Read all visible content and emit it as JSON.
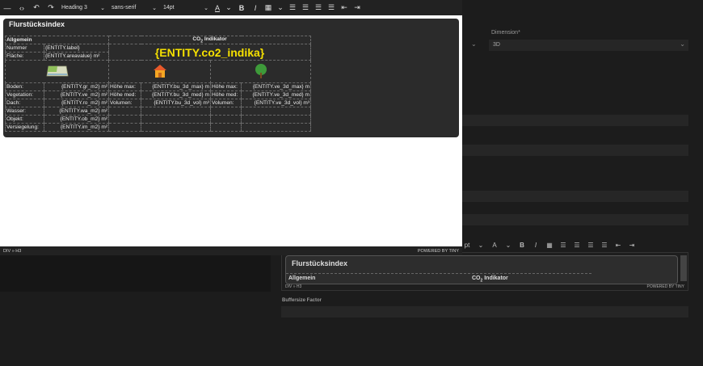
{
  "background": {
    "dimension_label": "Dimension*",
    "dimension_value": "3D",
    "buffersize_label": "Buffersize Factor",
    "mini_toolbar": {
      "font_size_tail": "pt",
      "text_color": "A",
      "bold": "B",
      "italic": "I"
    },
    "mini_editor": {
      "card_title": "Flurstücksindex",
      "allgemein": "Allgemein",
      "co2_label_prefix": "CO",
      "co2_label_sub": "2",
      "co2_label_suffix": " Indikator",
      "status_path": "DIV » H3",
      "powered": "POWERED BY TINY"
    }
  },
  "toolbar": {
    "block_format": "Heading 3",
    "font_family": "sans-serif",
    "font_size": "14pt",
    "text_color_icon": "A",
    "bold_label": "B",
    "italic_label": "I"
  },
  "card": {
    "title": "Flurstücksindex",
    "header_allgemein": "Allgemein",
    "header_co2_prefix": "CO",
    "header_co2_sub": "2",
    "header_co2_suffix": " Indikator",
    "co2_value": "{ENTITY.co2_indika}",
    "rows_general": [
      {
        "label": "Nummer",
        "value": "{ENTITY.label}"
      },
      {
        "label": "Fläche:",
        "value": "{ENTITY.areavalue} m²"
      }
    ],
    "rows_detail": [
      {
        "label": "Boden:",
        "value": "{ENTITY.gr_m2} m²",
        "l2": "Höhe max:",
        "v2": "{ENTITY.bu_3d_max} m",
        "l3": "Höhe max:",
        "v3": "{ENTITY.ve_3d_max} m"
      },
      {
        "label": "Vegetation:",
        "value": "{ENTITY.ve_m2} m²",
        "l2": "Höhe med:",
        "v2": "{ENTITY.bu_3d_med} m",
        "l3": "Höhe med:",
        "v3": "{ENTITY.ve_3d_med} m"
      },
      {
        "label": "Dach:",
        "value": "{ENTITY.ro_m2} m²",
        "l2": "Volumen:",
        "v2": "{ENTITY.bu_3d_vol} m³",
        "l3": "Volumen:",
        "v3": "{ENTITY.ve_3d_vol} m³"
      },
      {
        "label": "Wasser:",
        "value": "{ENTITY.wa_m2} m²",
        "l2": "",
        "v2": "",
        "l3": "",
        "v3": ""
      },
      {
        "label": "Objekt:",
        "value": "{ENTITY.ob_m2} m²",
        "l2": "",
        "v2": "",
        "l3": "",
        "v3": ""
      },
      {
        "label": "Versiegelung:",
        "value": "{ENTITY.im_m2} m²",
        "l2": "",
        "v2": "",
        "l3": "",
        "v3": ""
      }
    ],
    "icons": [
      "map-icon",
      "house-icon",
      "tree-icon"
    ]
  },
  "statusbar": {
    "path": "DIV » H3",
    "powered": "POWERED BY TINY"
  },
  "colors": {
    "co2_value": "#f5e000",
    "card_bg": "#2b2b2b",
    "toolbar_bg": "#222222"
  }
}
